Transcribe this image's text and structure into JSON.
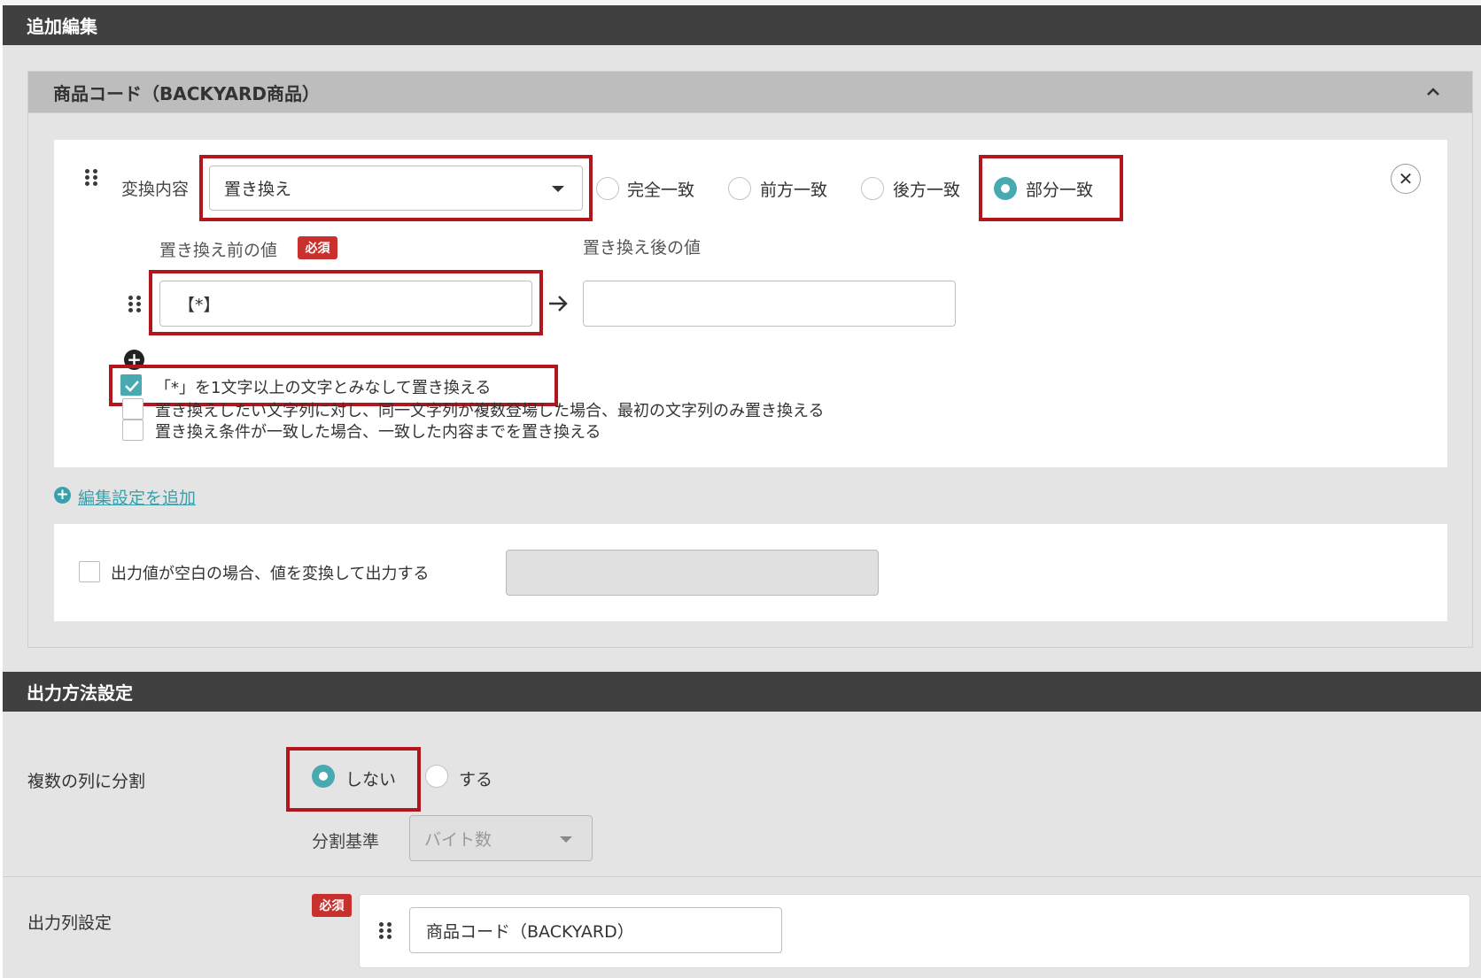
{
  "section_edit": {
    "title": "追加編集"
  },
  "panel": {
    "title": "商品コード（BACKYARD商品）",
    "collapse_icon": "chevron-up-icon"
  },
  "rule": {
    "label": "変換内容",
    "conversion_select": {
      "value": "置き換え"
    },
    "match_options": [
      {
        "label": "完全一致",
        "selected": false
      },
      {
        "label": "前方一致",
        "selected": false
      },
      {
        "label": "後方一致",
        "selected": false
      },
      {
        "label": "部分一致",
        "selected": true
      }
    ],
    "before_label": "置き換え前の値",
    "required_badge": "必須",
    "after_label": "置き換え後の値",
    "before_value": "【*】",
    "after_value": "",
    "arrow": "→",
    "checkboxes": [
      {
        "label": "「*」を1文字以上の文字とみなして置き換える",
        "checked": true
      },
      {
        "label": "置き換えしたい文字列に対し、同一文字列が複数登場した場合、最初の文字列のみ置き換える",
        "checked": false
      },
      {
        "label": "置き換え条件が一致した場合、一致した内容までを置き換える",
        "checked": false
      }
    ]
  },
  "add_edit_link": {
    "label": "編集設定を追加"
  },
  "blank_output": {
    "label": "出力値が空白の場合、値を変換して出力する",
    "checked": false,
    "value": ""
  },
  "section_output": {
    "title": "出力方法設定"
  },
  "split": {
    "label": "複数の列に分割",
    "options": [
      {
        "label": "しない",
        "selected": true
      },
      {
        "label": "する",
        "selected": false
      }
    ],
    "basis_label": "分割基準",
    "basis_value": "バイト数"
  },
  "output_column": {
    "label": "出力列設定",
    "required_badge": "必須",
    "value": "商品コード（BACKYARD）"
  },
  "colors": {
    "accent": "#48a9b0",
    "highlight": "#b3151c",
    "header": "#404040",
    "badge": "#c8302e"
  }
}
